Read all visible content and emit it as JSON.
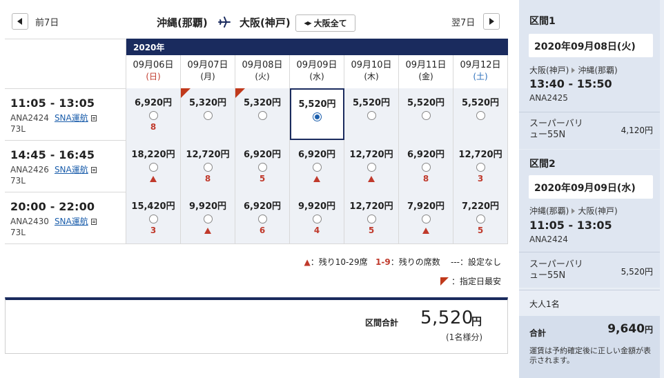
{
  "nav": {
    "prev_label": "前7日",
    "next_label": "翌7日",
    "origin": "沖縄(那覇)",
    "destination": "大阪(神戸)",
    "all_button": "大阪全て"
  },
  "year": "2020年",
  "dates": [
    {
      "date": "09月06日",
      "dow": "(日)",
      "type": "sun"
    },
    {
      "date": "09月07日",
      "dow": "(月)",
      "type": ""
    },
    {
      "date": "09月08日",
      "dow": "(火)",
      "type": ""
    },
    {
      "date": "09月09日",
      "dow": "(水)",
      "type": ""
    },
    {
      "date": "09月10日",
      "dow": "(木)",
      "type": ""
    },
    {
      "date": "09月11日",
      "dow": "(金)",
      "type": ""
    },
    {
      "date": "09月12日",
      "dow": "(土)",
      "type": "sat"
    }
  ],
  "flights": [
    {
      "time": "11:05 - 13:05",
      "flight_no": "ANA2424",
      "operator": "SNA運航",
      "aircraft": "73L",
      "fares": [
        {
          "price": "6,920円",
          "seats": "8",
          "lowest": false
        },
        {
          "price": "5,320円",
          "seats": "",
          "lowest": true
        },
        {
          "price": "5,320円",
          "seats": "",
          "lowest": true
        },
        {
          "price": "5,520円",
          "seats": "",
          "lowest": false,
          "selected": true
        },
        {
          "price": "5,520円",
          "seats": "",
          "lowest": false
        },
        {
          "price": "5,520円",
          "seats": "",
          "lowest": false
        },
        {
          "price": "5,520円",
          "seats": "",
          "lowest": false
        }
      ]
    },
    {
      "time": "14:45 - 16:45",
      "flight_no": "ANA2426",
      "operator": "SNA運航",
      "aircraft": "73L",
      "fares": [
        {
          "price": "18,220円",
          "seats": "▲",
          "lowest": false
        },
        {
          "price": "12,720円",
          "seats": "8",
          "lowest": false
        },
        {
          "price": "6,920円",
          "seats": "5",
          "lowest": false
        },
        {
          "price": "6,920円",
          "seats": "▲",
          "lowest": false
        },
        {
          "price": "12,720円",
          "seats": "▲",
          "lowest": false
        },
        {
          "price": "6,920円",
          "seats": "8",
          "lowest": false
        },
        {
          "price": "12,720円",
          "seats": "3",
          "lowest": false
        }
      ]
    },
    {
      "time": "20:00 - 22:00",
      "flight_no": "ANA2430",
      "operator": "SNA運航",
      "aircraft": "73L",
      "fares": [
        {
          "price": "15,420円",
          "seats": "3",
          "lowest": false
        },
        {
          "price": "9,920円",
          "seats": "▲",
          "lowest": false
        },
        {
          "price": "6,920円",
          "seats": "6",
          "lowest": false
        },
        {
          "price": "9,920円",
          "seats": "4",
          "lowest": false
        },
        {
          "price": "12,720円",
          "seats": "5",
          "lowest": false
        },
        {
          "price": "7,920円",
          "seats": "▲",
          "lowest": false
        },
        {
          "price": "7,220円",
          "seats": "5",
          "lowest": false
        }
      ]
    }
  ],
  "legend": {
    "tri_text": "：残り10-29席",
    "range": "1-9",
    "range_text": "：残りの席数",
    "none_text": "---：設定なし",
    "lowest_text": "：指定日最安"
  },
  "total": {
    "label": "区間合計",
    "value": "5,520",
    "unit": "円",
    "note": "(1名様分)"
  },
  "sidebar": {
    "seg1": {
      "head": "区間1",
      "date": "2020年09月08日(火)",
      "from": "大阪(神戸)",
      "to": "沖縄(那覇)",
      "time": "13:40 - 15:50",
      "flight_no": "ANA2425",
      "fare_line1": "スーパーバリ",
      "fare_line2": "ュー55N",
      "price": "4,120円"
    },
    "seg2": {
      "head": "区間2",
      "date": "2020年09月09日(水)",
      "from": "沖縄(那覇)",
      "to": "大阪(神戸)",
      "time": "11:05 - 13:05",
      "flight_no": "ANA2424",
      "fare_line1": "スーパーバリ",
      "fare_line2": "ュー55N",
      "price": "5,520円"
    },
    "passengers": "大人1名",
    "total_label": "合計",
    "total_value": "9,640",
    "total_unit": "円",
    "note": "運賃は予約確定後に正しい金額が表示されます。"
  },
  "colors": {
    "navy": "#1a2b5e",
    "accent_red": "#c0392b",
    "cell_bg": "#eef1f6",
    "sidebar_bg": "#e8edf5"
  }
}
